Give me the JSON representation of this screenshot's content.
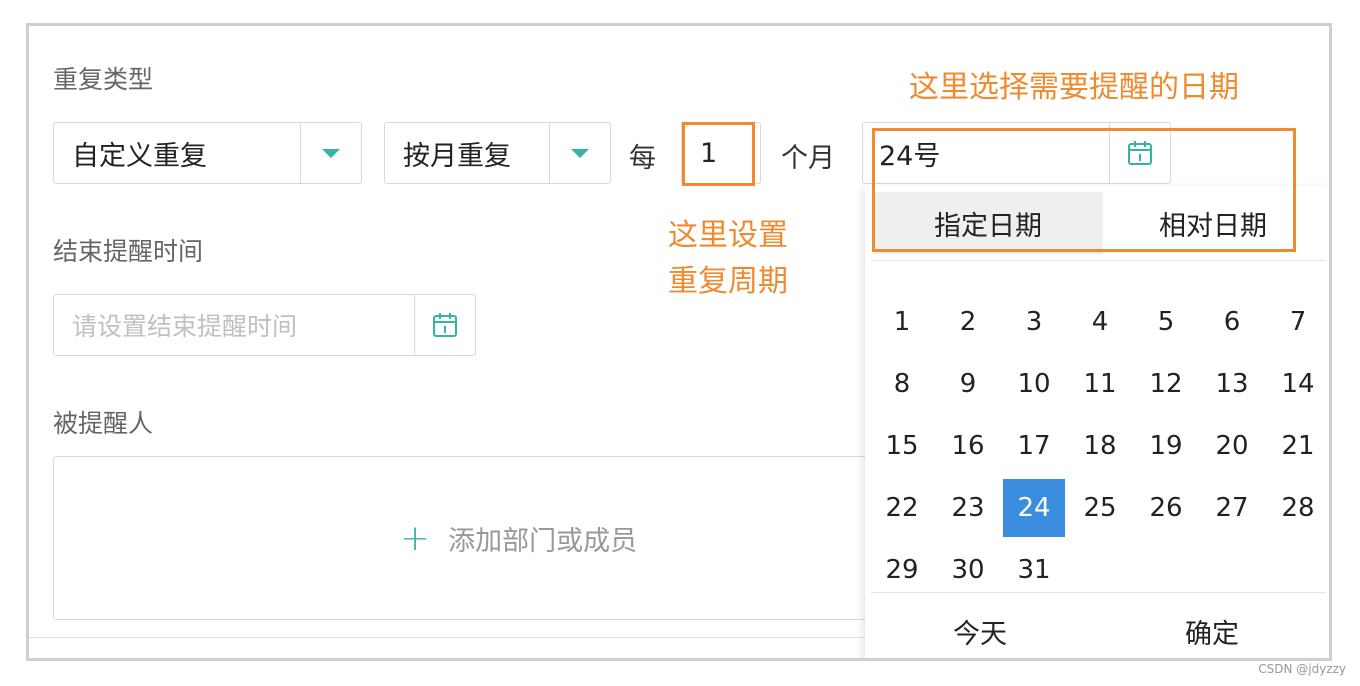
{
  "form": {
    "repeat_type_label": "重复类型",
    "repeat_mode_value": "自定义重复",
    "repeat_unit_value": "按月重复",
    "every_label": "每",
    "interval_value": "1",
    "interval_unit": "个月",
    "date_value": "24号",
    "end_time_label": "结束提醒时间",
    "end_time_placeholder": "请设置结束提醒时间",
    "reminded_people_label": "被提醒人",
    "add_member_label": "添加部门或成员",
    "add_member_icon": "plus-icon"
  },
  "annotations": {
    "date_hint": "这里选择需要提醒的日期",
    "period_hint_line1": "这里设置",
    "period_hint_line2": "重复周期",
    "color": "#ee8b2f"
  },
  "date_picker": {
    "tabs": [
      "指定日期",
      "相对日期"
    ],
    "active_tab": 0,
    "days": [
      "1",
      "2",
      "3",
      "4",
      "5",
      "6",
      "7",
      "8",
      "9",
      "10",
      "11",
      "12",
      "13",
      "14",
      "15",
      "16",
      "17",
      "18",
      "19",
      "20",
      "21",
      "22",
      "23",
      "24",
      "25",
      "26",
      "27",
      "28",
      "29",
      "30",
      "31"
    ],
    "selected_day": "24",
    "selected_color": "#3b8ede",
    "today_label": "今天",
    "confirm_label": "确定"
  },
  "colors": {
    "accent": "#36b4a3"
  },
  "watermark": "CSDN @jdyzzy"
}
